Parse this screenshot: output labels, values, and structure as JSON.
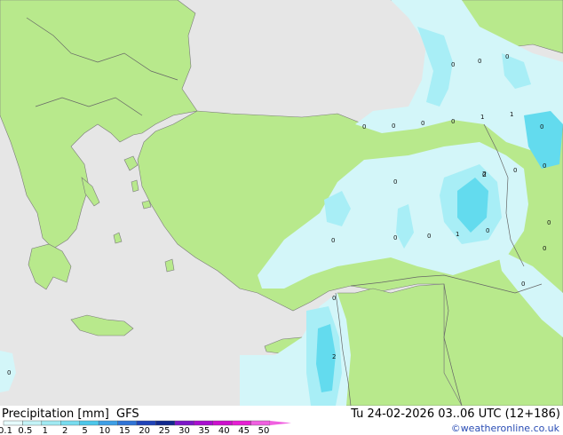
{
  "header": {
    "legend_title": "Precipitation [mm]",
    "model": "GFS",
    "valid_time": "Tu 24-02-2026 03..06 UTC (12+186)"
  },
  "credit": "©weatheronline.co.uk",
  "colors": {
    "land": "#b8e98c",
    "sea_no_data": "#e6e6e6",
    "precip_light": "#d3f6f9",
    "precip_medium": "#a8eef6",
    "precip_heavy": "#63dbee",
    "border": "#666666"
  },
  "legend": {
    "labels": [
      "0.1",
      "0.5",
      "1",
      "2",
      "5",
      "10",
      "15",
      "20",
      "25",
      "30",
      "35",
      "40",
      "45",
      "50"
    ],
    "colors": [
      "#e6fbfc",
      "#c4f3f7",
      "#a0e9f2",
      "#78dcef",
      "#4cc7ea",
      "#3d9fe6",
      "#2f74d6",
      "#1f43b8",
      "#122a8e",
      "#7c18c8",
      "#a80ecf",
      "#cc10cc",
      "#e61ed2",
      "#f060e0"
    ]
  },
  "point_values": [
    "0",
    "0",
    "0",
    "0",
    "0",
    "0",
    "0",
    "1",
    "1",
    "0",
    "0",
    "0",
    "0",
    "0",
    "2",
    "0",
    "0",
    "0",
    "0",
    "1",
    "0",
    "0",
    "0",
    "2",
    "0",
    "0"
  ]
}
